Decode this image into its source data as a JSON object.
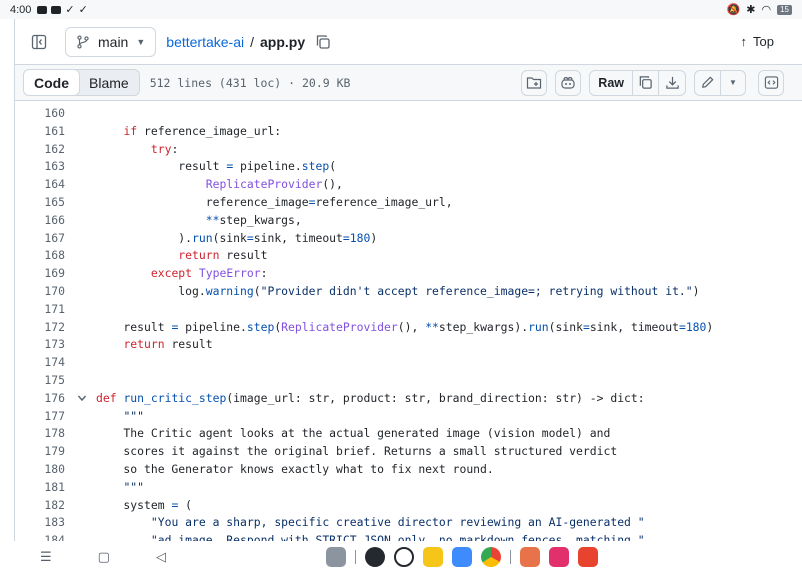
{
  "status_bar": {
    "time": "4:00",
    "battery": "15"
  },
  "header": {
    "branch": "main",
    "repo": "bettertake-ai",
    "separator": "/",
    "file": "app.py",
    "top_label": "Top"
  },
  "toolbar": {
    "tabs": [
      "Code",
      "Blame"
    ],
    "meta": "512 lines (431 loc) · 20.9 KB",
    "raw_label": "Raw"
  },
  "code_lines": [
    {
      "n": "160",
      "t": ""
    },
    {
      "n": "161",
      "t": "    if reference_image_url:"
    },
    {
      "n": "162",
      "t": "        try:"
    },
    {
      "n": "163",
      "t": "            result = pipeline.step("
    },
    {
      "n": "164",
      "t": "                ReplicateProvider(),"
    },
    {
      "n": "165",
      "t": "                reference_image=reference_image_url,"
    },
    {
      "n": "166",
      "t": "                **step_kwargs,"
    },
    {
      "n": "167",
      "t": "            ).run(sink=sink, timeout=180)"
    },
    {
      "n": "168",
      "t": "            return result"
    },
    {
      "n": "169",
      "t": "        except TypeError:"
    },
    {
      "n": "170",
      "t": "            log.warning(\"Provider didn't accept reference_image=; retrying without it.\")"
    },
    {
      "n": "171",
      "t": ""
    },
    {
      "n": "172",
      "t": "    result = pipeline.step(ReplicateProvider(), **step_kwargs).run(sink=sink, timeout=180)"
    },
    {
      "n": "173",
      "t": "    return result"
    },
    {
      "n": "174",
      "t": ""
    },
    {
      "n": "175",
      "t": ""
    },
    {
      "n": "176",
      "t": "def run_critic_step(image_url: str, product: str, brand_direction: str) -> dict:"
    },
    {
      "n": "177",
      "t": "    \"\"\""
    },
    {
      "n": "178",
      "t": "    The Critic agent looks at the actual generated image (vision model) and"
    },
    {
      "n": "179",
      "t": "    scores it against the original brief. Returns a small structured verdict"
    },
    {
      "n": "180",
      "t": "    so the Generator knows exactly what to fix next round."
    },
    {
      "n": "181",
      "t": "    \"\"\""
    },
    {
      "n": "182",
      "t": "    system = ("
    },
    {
      "n": "183",
      "t": "        \"You are a sharp, specific creative director reviewing an AI-generated \""
    },
    {
      "n": "184",
      "t": "        \"ad image. Respond with STRICT JSON only, no markdown fences, matching \""
    }
  ]
}
